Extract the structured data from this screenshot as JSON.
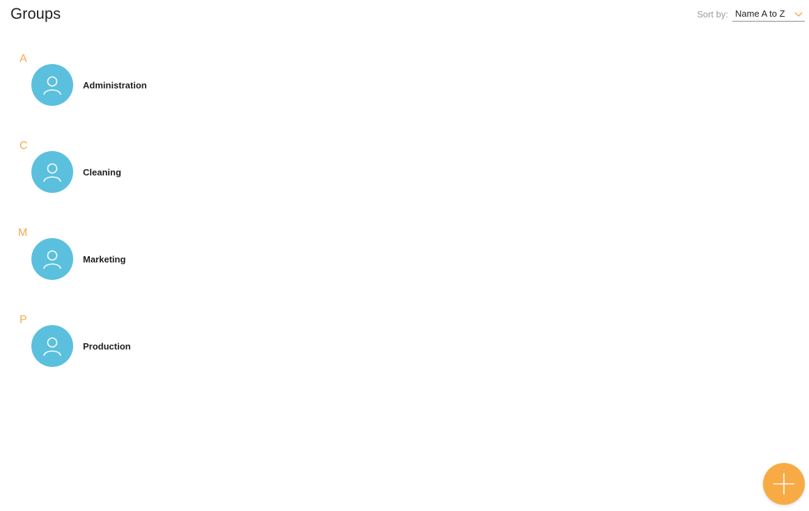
{
  "header": {
    "title": "Groups"
  },
  "sort": {
    "label": "Sort by:",
    "value": "Name A to Z",
    "icon": "chevron-down-icon"
  },
  "sections": [
    {
      "letter": "A",
      "groups": [
        {
          "name": "Administration",
          "icon": "user-icon"
        }
      ]
    },
    {
      "letter": "C",
      "groups": [
        {
          "name": "Cleaning",
          "icon": "user-icon"
        }
      ]
    },
    {
      "letter": "M",
      "groups": [
        {
          "name": "Marketing",
          "icon": "user-icon"
        }
      ]
    },
    {
      "letter": "P",
      "groups": [
        {
          "name": "Production",
          "icon": "user-icon"
        }
      ]
    }
  ],
  "fab": {
    "icon": "plus-icon"
  },
  "colors": {
    "accent": "#f5a94a",
    "avatar": "#5bc0de",
    "fab": "#f8ab45"
  }
}
